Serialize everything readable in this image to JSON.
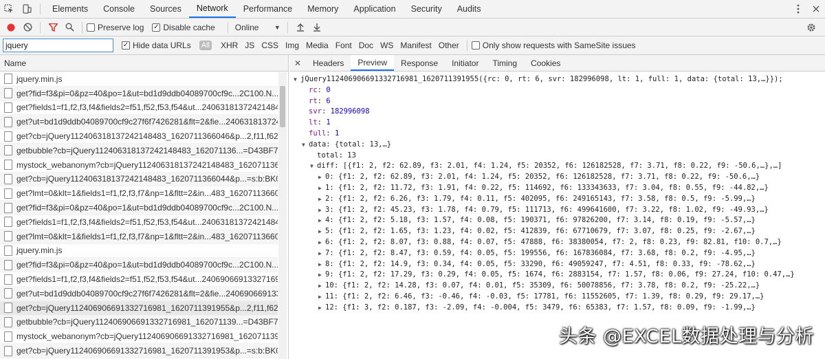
{
  "tabs": [
    "Elements",
    "Console",
    "Sources",
    "Network",
    "Performance",
    "Memory",
    "Application",
    "Security",
    "Audits"
  ],
  "active_tab": "Network",
  "toolbar": {
    "preserve_log": "Preserve log",
    "disable_cache": "Disable cache",
    "throttle": "Online"
  },
  "filter": {
    "value": "jquery",
    "hide_data_urls": "Hide data URLs",
    "all": "All",
    "types": [
      "XHR",
      "JS",
      "CSS",
      "Img",
      "Media",
      "Font",
      "Doc",
      "WS",
      "Manifest",
      "Other"
    ],
    "samesite": "Only show requests with SameSite issues"
  },
  "list_header": "Name",
  "requests": [
    "jquery.min.js",
    "get?fid=f3&pi=0&pz=40&po=1&ut=bd1d9ddb04089700cf9c...2C100.N...",
    "get?fields1=f1,f2,f3,f4&fields2=f51,f52,f53,f54&ut...240631813724214848",
    "get?ut=bd1d9ddb04089700cf9c27f6f7426281&flt=2&fie...240631813724214848",
    "get?cb=jQuery112406318137242148483_1620711366046&p...2,f11,f62,f1",
    "getbubble?cb=jQuery112406318137242148483_162071136...=D43BF722",
    "mystock_webanonym?cb=jQuery112406318137242148483_16207113660...",
    "get?cb=jQuery112406318137242148483_1620711366044&p...=s:b:BK042",
    "get?lmt=0&klt=1&fields1=f1,f2,f3,f7&np=1&fltt=2&in...483_16207113660",
    "get?fid=f3&pi=0&pz=40&po=1&ut=bd1d9ddb04089700cf9c...2C100.N...",
    "get?fields1=f1,f2,f3,f4&fields2=f51,f52,f53,f54&ut...240631813724214848",
    "get?lmt=0&klt=1&fields1=f1,f2,f3,f7&np=1&fltt=2&in...483_16207113660",
    "jquery.min.js",
    "get?fid=f3&pi=0&pz=40&po=1&ut=bd1d9ddb04089700cf9c...2C100.N...",
    "get?fields1=f1,f2,f3,f4&fields2=f51,f52,f53,f54&ut...240690669133271698",
    "get?ut=bd1d9ddb04089700cf9c27f6f7426281&flt=2&fie...240690669133",
    "get?cb=jQuery112406906691332716981_1620711391955&p...2,f11,f62,f1",
    "getbubble?cb=jQuery112406906691332716981_162071139...=D43BF722",
    "mystock_webanonym?cb=jQuery112406906691332716981_16207113919...",
    "get?cb=jQuery112406906691332716981_1620711391953&p...=s:b:BK042"
  ],
  "detail_tabs": [
    "Headers",
    "Preview",
    "Response",
    "Initiator",
    "Timing",
    "Cookies"
  ],
  "active_detail_tab": "Preview",
  "preview": {
    "root": "jQuery112406906691332716981_1620711391955({rc: 0, rt: 6, svr: 182996098, lt: 1, full: 1, data: {total: 13,…}});",
    "fields": [
      {
        "k": "rc",
        "v": "0"
      },
      {
        "k": "rt",
        "v": "6"
      },
      {
        "k": "svr",
        "v": "182996098"
      },
      {
        "k": "lt",
        "v": "1"
      },
      {
        "k": "full",
        "v": "1"
      }
    ],
    "data_label": "data: {total: 13,…}",
    "total_label": "total: 13",
    "diff_label": "diff: [{f1: 2, f2: 62.89, f3: 2.01, f4: 1.24, f5: 20352, f6: 126182528, f7: 3.71, f8: 0.22, f9: -50.6,…},…]",
    "items": [
      "0: {f1: 2, f2: 62.89, f3: 2.01, f4: 1.24, f5: 20352, f6: 126182528, f7: 3.71, f8: 0.22, f9: -50.6,…}",
      "1: {f1: 2, f2: 11.72, f3: 1.91, f4: 0.22, f5: 114692, f6: 133343633, f7: 3.04, f8: 0.55, f9: -44.82,…}",
      "2: {f1: 2, f2: 6.26, f3: 1.79, f4: 0.11, f5: 402095, f6: 249165143, f7: 3.58, f8: 0.5, f9: -5.99,…}",
      "3: {f1: 2, f2: 45.23, f3: 1.78, f4: 0.79, f5: 111713, f6: 499641600, f7: 3.22, f8: 1.02, f9: -49.93,…}",
      "4: {f1: 2, f2: 5.18, f3: 1.57, f4: 0.08, f5: 190371, f6: 97826200, f7: 3.14, f8: 0.19, f9: -5.57,…}",
      "5: {f1: 2, f2: 1.65, f3: 1.23, f4: 0.02, f5: 412839, f6: 67710679, f7: 3.07, f8: 0.25, f9: -2.67,…}",
      "6: {f1: 2, f2: 8.07, f3: 0.88, f4: 0.07, f5: 47888, f6: 38380054, f7: 2, f8: 0.23, f9: 82.81, f10: 0.7,…}",
      "7: {f1: 2, f2: 8.47, f3: 0.59, f4: 0.05, f5: 199556, f6: 167836084, f7: 3.68, f8: 0.2, f9: -4.95,…}",
      "8: {f1: 2, f2: 14.9, f3: 0.34, f4: 0.05, f5: 33290, f6: 49059247, f7: 4.51, f8: 0.33, f9: -78.62,…}",
      "9: {f1: 2, f2: 17.29, f3: 0.29, f4: 0.05, f5: 1674, f6: 2883154, f7: 1.57, f8: 0.06, f9: 27.24, f10: 0.47,…}",
      "10: {f1: 2, f2: 14.28, f3: 0.07, f4: 0.01, f5: 35309, f6: 50078856, f7: 3.78, f8: 0.2, f9: -25.22,…}",
      "11: {f1: 2, f2: 6.46, f3: -0.46, f4: -0.03, f5: 17781, f6: 11552605, f7: 1.39, f8: 0.29, f9: 29.17,…}",
      "12: {f1: 3, f2: 0.187, f3: -2.09, f4: -0.004, f5: 3479, f6: 65383, f7: 1.57, f8: 0.09, f9: -1.99,…}"
    ]
  },
  "watermark": "头条 @EXCEL数据处理与分析",
  "colors": {
    "accent": "#1a73e8",
    "record": "#e8322e",
    "filter": "#d93025"
  }
}
